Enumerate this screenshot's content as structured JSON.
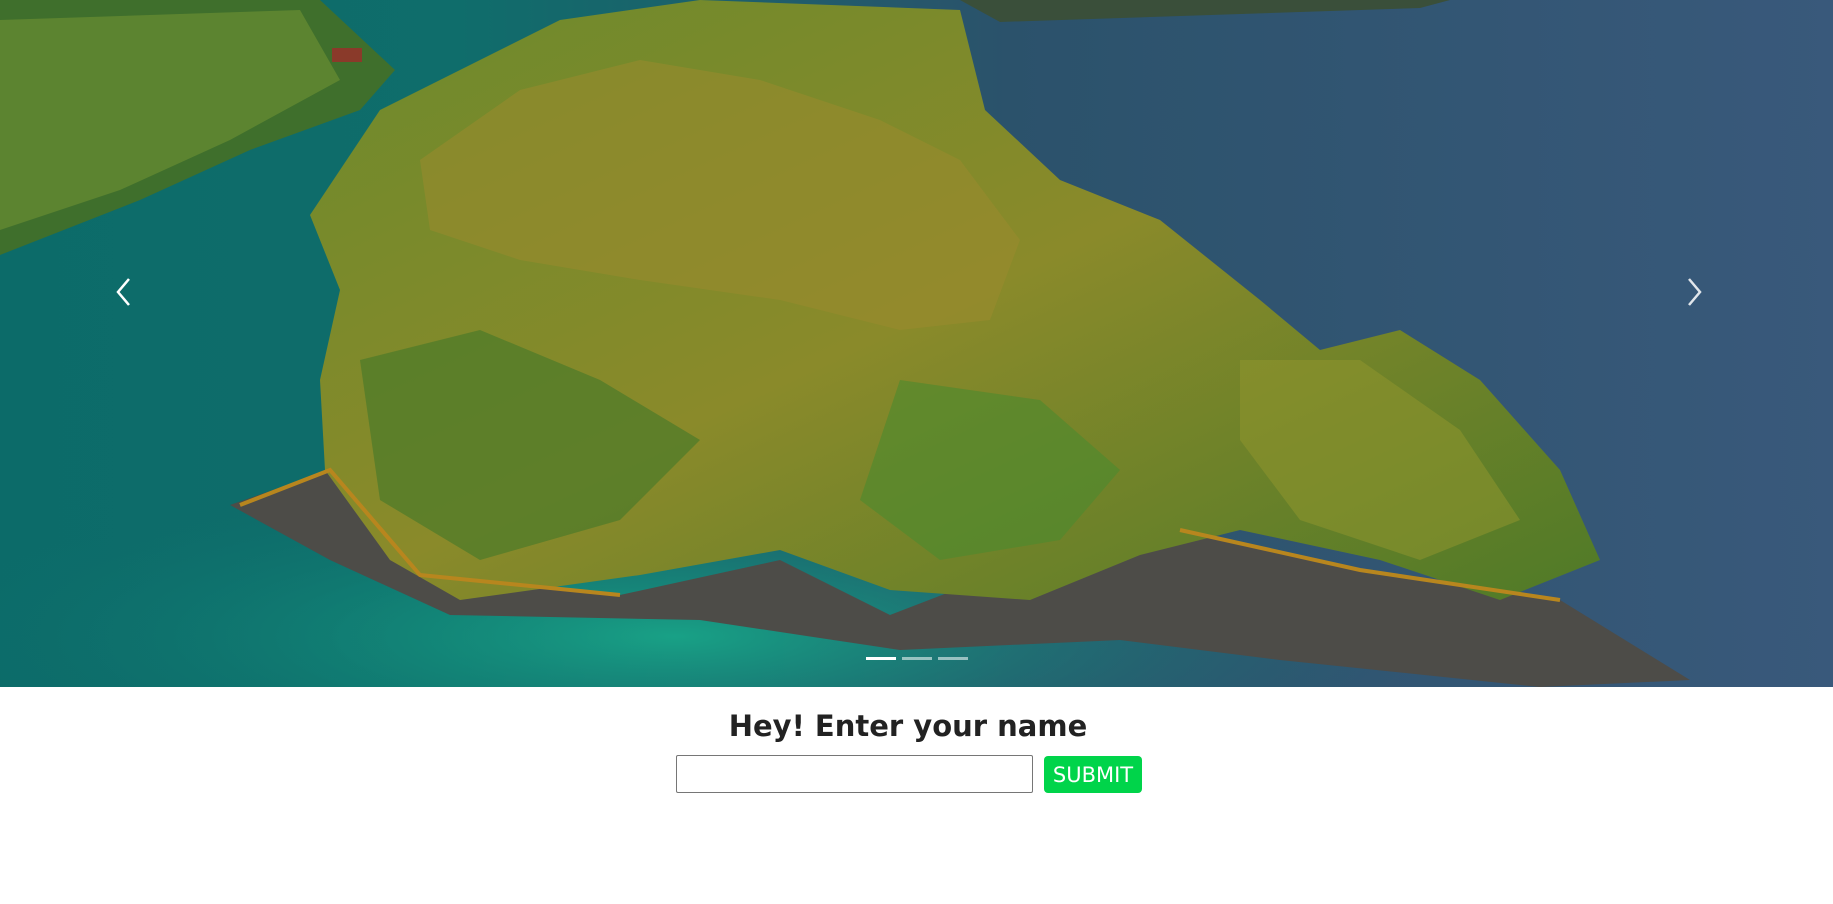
{
  "carousel": {
    "prev_icon": "chevron-left-icon",
    "next_icon": "chevron-right-icon",
    "indicators": [
      {
        "active": true
      },
      {
        "active": false
      },
      {
        "active": false
      }
    ]
  },
  "form": {
    "title": "Hey! Enter your name",
    "input_value": "",
    "input_placeholder": "",
    "submit_label": "SUBMIT"
  },
  "colors": {
    "submit_bg": "#00d44a",
    "water": "#0e6f6c",
    "forest": "#7a8a2a"
  }
}
